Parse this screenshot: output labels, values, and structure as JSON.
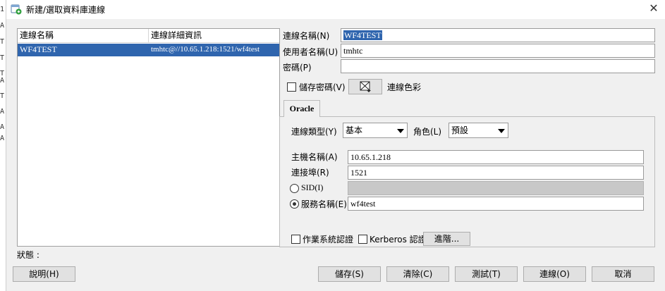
{
  "background_editor": {
    "lines": [
      "1",
      "A",
      "T",
      "T",
      "T",
      "A",
      "T",
      "A",
      "A",
      "A"
    ]
  },
  "window": {
    "title": "新建/選取資料庫連線",
    "close_label": "✕"
  },
  "connection_list": {
    "columns": [
      "連線名稱",
      "連線詳細資訊"
    ],
    "rows": [
      {
        "name": "WF4TEST",
        "details": "tmhtc@//10.65.1.218:1521/wf4test"
      }
    ]
  },
  "form": {
    "connection_name": {
      "label": "連線名稱(N)",
      "value": "WF4TEST"
    },
    "username": {
      "label": "使用者名稱(U)",
      "value": "tmhtc"
    },
    "password": {
      "label": "密碼(P)",
      "value": ""
    },
    "save_password": {
      "label": "儲存密碼(V)",
      "checked": false
    },
    "connection_color": {
      "label": "連線色彩"
    }
  },
  "tab": {
    "label": "Oracle",
    "connection_type": {
      "label": "連線類型(Y)",
      "value": "基本"
    },
    "role": {
      "label": "角色(L)",
      "value": "預設"
    },
    "hostname": {
      "label": "主機名稱(A)",
      "value": "10.65.1.218"
    },
    "port": {
      "label": "連接埠(R)",
      "value": "1521"
    },
    "sid": {
      "label": "SID(I)",
      "value": "",
      "selected": false
    },
    "service_name": {
      "label": "服務名稱(E)",
      "value": "wf4test",
      "selected": true
    },
    "os_auth": {
      "label": "作業系統認證",
      "checked": false
    },
    "kerberos_auth": {
      "label": "Kerberos 認證",
      "checked": false
    },
    "advanced_label": "進階..."
  },
  "status": {
    "label": "狀態 :"
  },
  "buttons": {
    "help": "說明(H)",
    "save": "儲存(S)",
    "clear": "清除(C)",
    "test": "測試(T)",
    "connect": "連線(O)",
    "cancel": "取消"
  },
  "colors": {
    "selection": "#2f65ae",
    "dialog_bg": "#f0f0f0",
    "disabled_field": "#c8c8c8"
  },
  "icons": {
    "app": "database-add-icon",
    "color_picker": "color-swatch-icon"
  }
}
